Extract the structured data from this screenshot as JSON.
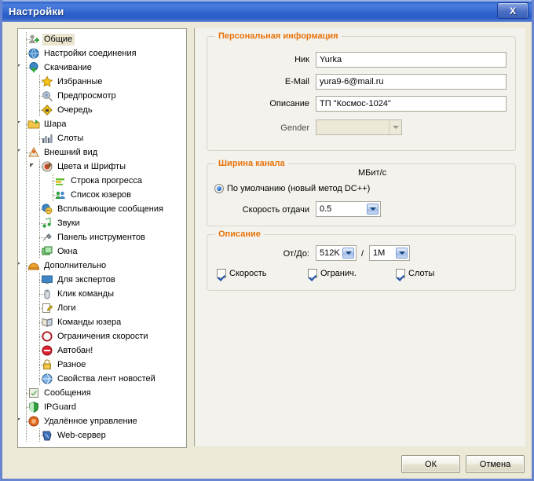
{
  "window": {
    "title": "Настройки",
    "close_label": "X",
    "close_icon": "close-icon"
  },
  "tree": {
    "items": [
      {
        "label": "Общие",
        "depth": 0,
        "icon": "users-add-icon",
        "selected": true,
        "expander": "none"
      },
      {
        "label": "Настройки соединения",
        "depth": 0,
        "icon": "globe-icon",
        "selected": false,
        "expander": "none"
      },
      {
        "label": "Скачивание",
        "depth": 0,
        "icon": "download-globe-icon",
        "selected": false,
        "expander": "expanded"
      },
      {
        "label": "Избранные",
        "depth": 1,
        "icon": "star-icon",
        "selected": false,
        "expander": "none"
      },
      {
        "label": "Предпросмотр",
        "depth": 1,
        "icon": "preview-icon",
        "selected": false,
        "expander": "none"
      },
      {
        "label": "Очередь",
        "depth": 1,
        "icon": "queue-icon",
        "selected": false,
        "expander": "none"
      },
      {
        "label": "Шара",
        "depth": 0,
        "icon": "share-folder-icon",
        "selected": false,
        "expander": "expanded"
      },
      {
        "label": "Слоты",
        "depth": 1,
        "icon": "bars-icon",
        "selected": false,
        "expander": "none"
      },
      {
        "label": "Внешний вид",
        "depth": 0,
        "icon": "appearance-icon",
        "selected": false,
        "expander": "expanded"
      },
      {
        "label": "Цвета и Шрифты",
        "depth": 1,
        "icon": "palette-icon",
        "selected": false,
        "expander": "expanded"
      },
      {
        "label": "Строка прогресса",
        "depth": 2,
        "icon": "progressbar-icon",
        "selected": false,
        "expander": "none"
      },
      {
        "label": "Список юзеров",
        "depth": 2,
        "icon": "userlist-icon",
        "selected": false,
        "expander": "none"
      },
      {
        "label": "Всплывающие сообщения",
        "depth": 1,
        "icon": "popup-icon",
        "selected": false,
        "expander": "none"
      },
      {
        "label": "Звуки",
        "depth": 1,
        "icon": "sound-icon",
        "selected": false,
        "expander": "none"
      },
      {
        "label": "Панель инструментов",
        "depth": 1,
        "icon": "toolbar-icon",
        "selected": false,
        "expander": "none"
      },
      {
        "label": "Окна",
        "depth": 1,
        "icon": "windows-icon",
        "selected": false,
        "expander": "none"
      },
      {
        "label": "Дополнительно",
        "depth": 0,
        "icon": "helmet-icon",
        "selected": false,
        "expander": "expanded"
      },
      {
        "label": "Для экспертов",
        "depth": 1,
        "icon": "monitor-icon",
        "selected": false,
        "expander": "none"
      },
      {
        "label": "Клик команды",
        "depth": 1,
        "icon": "mouse-icon",
        "selected": false,
        "expander": "none"
      },
      {
        "label": "Логи",
        "depth": 1,
        "icon": "log-icon",
        "selected": false,
        "expander": "none"
      },
      {
        "label": "Команды юзера",
        "depth": 1,
        "icon": "book-icon",
        "selected": false,
        "expander": "none"
      },
      {
        "label": "Ограничения скорости",
        "depth": 1,
        "icon": "speedlimit-icon",
        "selected": false,
        "expander": "none"
      },
      {
        "label": "Автобан!",
        "depth": 1,
        "icon": "ban-icon",
        "selected": false,
        "expander": "none"
      },
      {
        "label": "Разное",
        "depth": 1,
        "icon": "lock-icon",
        "selected": false,
        "expander": "none"
      },
      {
        "label": "Свойства лент новостей",
        "depth": 1,
        "icon": "rss-globe-icon",
        "selected": false,
        "expander": "none"
      },
      {
        "label": "Сообщения",
        "depth": 0,
        "icon": "message-check-icon",
        "selected": false,
        "expander": "none"
      },
      {
        "label": "IPGuard",
        "depth": 0,
        "icon": "shield-icon",
        "selected": false,
        "expander": "none"
      },
      {
        "label": "Удалённое управление",
        "depth": 0,
        "icon": "remote-icon",
        "selected": false,
        "expander": "expanded"
      },
      {
        "label": "Web-сервер",
        "depth": 1,
        "icon": "webserver-icon",
        "selected": false,
        "expander": "none"
      }
    ]
  },
  "personal": {
    "legend": "Персональная информация",
    "nick_label": "Ник",
    "nick_value": "Yurka",
    "email_label": "E-Mail",
    "email_value": "yura9-6@mail.ru",
    "description_label": "Описание",
    "description_value": "ТП \"Космос-1024\"",
    "gender_label": "Gender",
    "gender_value": ""
  },
  "bandwidth": {
    "legend": "Ширина канала",
    "unit_label": "МБит/с",
    "default_radio_label": "По умолчанию (новый метод DC++)",
    "upload_speed_label": "Скорость отдачи",
    "upload_speed_value": "0.5"
  },
  "description": {
    "legend": "Описание",
    "range_label": "От/До:",
    "range_from_value": "512K",
    "range_separator": "/",
    "range_to_value": "1M",
    "check_speed_label": "Скорость",
    "check_limit_label": "Огранич.",
    "check_slots_label": "Слоты"
  },
  "footer": {
    "ok_label": "ОК",
    "cancel_label": "Отмена"
  }
}
